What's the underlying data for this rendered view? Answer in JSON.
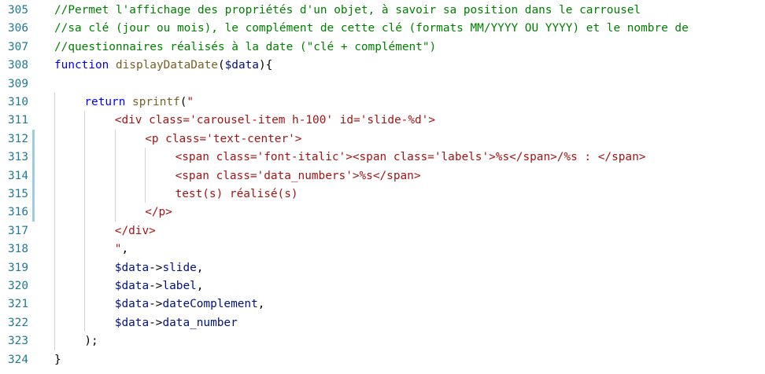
{
  "editor": {
    "lines": [
      {
        "number": "305",
        "indent": 0,
        "tokens": [
          {
            "t": "//Permet l'affichage des propriétés d'un objet, à savoir sa position dans le carrousel",
            "c": "comment"
          }
        ]
      },
      {
        "number": "306",
        "indent": 0,
        "tokens": [
          {
            "t": "//sa clé (jour ou mois), le complément de cette clé (formats MM/YYYY OU YYYY) et le nombre de",
            "c": "comment"
          }
        ]
      },
      {
        "number": "307",
        "indent": 0,
        "tokens": [
          {
            "t": "//questionnaires réalisés à la date (\"clé + complément\")",
            "c": "comment"
          }
        ]
      },
      {
        "number": "308",
        "indent": 0,
        "tokens": [
          {
            "t": "function",
            "c": "keyword"
          },
          {
            "t": " ",
            "c": "plain"
          },
          {
            "t": "displayDataDate",
            "c": "func"
          },
          {
            "t": "(",
            "c": "plain"
          },
          {
            "t": "$data",
            "c": "var"
          },
          {
            "t": "){",
            "c": "plain"
          }
        ]
      },
      {
        "number": "309",
        "indent": 0,
        "tokens": []
      },
      {
        "number": "310",
        "indent": 1,
        "tokens": [
          {
            "t": "return",
            "c": "keyword"
          },
          {
            "t": " ",
            "c": "plain"
          },
          {
            "t": "sprintf",
            "c": "func"
          },
          {
            "t": "(",
            "c": "plain"
          },
          {
            "t": "\"",
            "c": "string"
          }
        ]
      },
      {
        "number": "311",
        "indent": 2,
        "tokens": [
          {
            "t": "<div class='carousel-item h-100' id='slide-%d'>",
            "c": "string"
          }
        ]
      },
      {
        "number": "312",
        "indent": 3,
        "tokens": [
          {
            "t": "<p class='text-center'>",
            "c": "string"
          }
        ]
      },
      {
        "number": "313",
        "indent": 4,
        "tokens": [
          {
            "t": "<span class='font-italic'><span class='labels'>%s</span>/%s : </span>",
            "c": "string"
          }
        ]
      },
      {
        "number": "314",
        "indent": 4,
        "tokens": [
          {
            "t": "<span class='data_numbers'>%s</span>",
            "c": "string"
          }
        ]
      },
      {
        "number": "315",
        "indent": 4,
        "tokens": [
          {
            "t": "test(s) réalisé(s)",
            "c": "string"
          }
        ]
      },
      {
        "number": "316",
        "indent": 3,
        "tokens": [
          {
            "t": "</p>",
            "c": "string"
          }
        ]
      },
      {
        "number": "317",
        "indent": 2,
        "tokens": [
          {
            "t": "</div>",
            "c": "string"
          }
        ]
      },
      {
        "number": "318",
        "indent": 2,
        "tokens": [
          {
            "t": "\"",
            "c": "string"
          },
          {
            "t": ",",
            "c": "plain"
          }
        ]
      },
      {
        "number": "319",
        "indent": 2,
        "tokens": [
          {
            "t": "$data",
            "c": "var"
          },
          {
            "t": "->",
            "c": "plain"
          },
          {
            "t": "slide",
            "c": "var"
          },
          {
            "t": ",",
            "c": "plain"
          }
        ]
      },
      {
        "number": "320",
        "indent": 2,
        "tokens": [
          {
            "t": "$data",
            "c": "var"
          },
          {
            "t": "->",
            "c": "plain"
          },
          {
            "t": "label",
            "c": "var"
          },
          {
            "t": ",",
            "c": "plain"
          }
        ]
      },
      {
        "number": "321",
        "indent": 2,
        "tokens": [
          {
            "t": "$data",
            "c": "var"
          },
          {
            "t": "->",
            "c": "plain"
          },
          {
            "t": "dateComplement",
            "c": "var"
          },
          {
            "t": ",",
            "c": "plain"
          }
        ]
      },
      {
        "number": "322",
        "indent": 2,
        "tokens": [
          {
            "t": "$data",
            "c": "var"
          },
          {
            "t": "->",
            "c": "plain"
          },
          {
            "t": "data_number",
            "c": "var"
          }
        ]
      },
      {
        "number": "323",
        "indent": 1,
        "tokens": [
          {
            "t": ");",
            "c": "plain"
          }
        ]
      },
      {
        "number": "324",
        "indent": 0,
        "tokens": [
          {
            "t": "}",
            "c": "plain"
          }
        ]
      }
    ],
    "modified_lines": [
      "312",
      "313",
      "314",
      "315",
      "316"
    ],
    "colors": {
      "line_number": "#237893",
      "comment": "#008000",
      "keyword": "#0000ff",
      "function": "#795e26",
      "variable": "#001080",
      "string": "#a31515",
      "modified_marker": "#9ccde8",
      "indent_guide": "#d3d3d3"
    }
  }
}
